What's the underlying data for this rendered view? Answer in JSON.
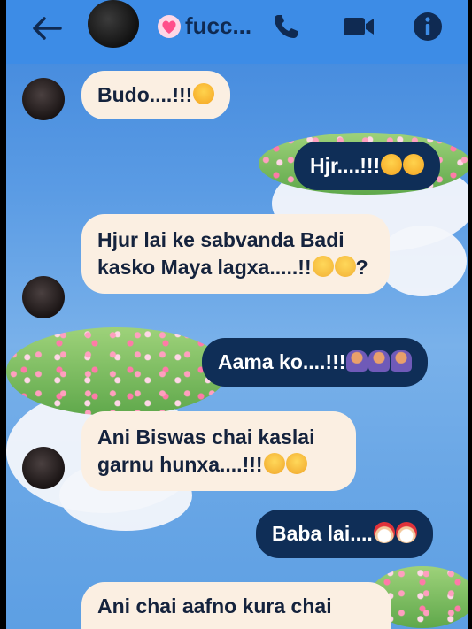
{
  "header": {
    "contact_name": "fucc...",
    "icons": [
      "back-arrow-icon",
      "heart-icon",
      "phone-icon",
      "video-camera-icon",
      "info-icon"
    ],
    "accent_color": "#3d8ce6"
  },
  "messages": [
    {
      "direction": "incoming",
      "text": "Budo....!!!",
      "emoji": [
        "face-blowing-kiss"
      ]
    },
    {
      "direction": "outgoing",
      "text": "Hjr....!!!",
      "emoji": [
        "face-blowing-kiss",
        "face-blowing-kiss"
      ]
    },
    {
      "direction": "incoming",
      "text": "Hjur lai ke sabvanda Badi kasko Maya lagxa.....!!",
      "emoji": [
        "pensive-face",
        "pensive-face"
      ],
      "suffix": "?"
    },
    {
      "direction": "outgoing",
      "text": "Aama ko....!!!",
      "emoji": [
        "person-tipping-hand",
        "person-tipping-hand",
        "person-tipping-hand"
      ]
    },
    {
      "direction": "incoming",
      "text": "Ani Biswas chai kaslai garnu hunxa....!!!",
      "emoji": [
        "pleading-face",
        "flushed-face"
      ]
    },
    {
      "direction": "outgoing",
      "text": "Baba lai....",
      "emoji": [
        "santa",
        "santa"
      ]
    },
    {
      "direction": "incoming",
      "text": "Ani chai aafno kura chai",
      "emoji": []
    }
  ],
  "colors": {
    "incoming_bubble": "#fbefe2",
    "outgoing_bubble": "#0f2e57",
    "incoming_text": "#15233d",
    "outgoing_text": "#ffffff"
  }
}
